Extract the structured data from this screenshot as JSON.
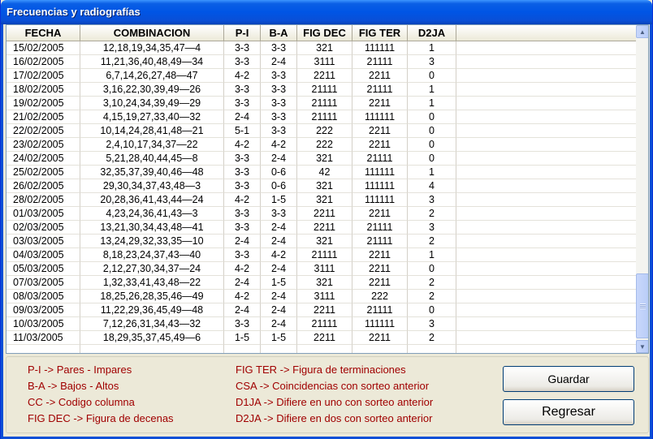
{
  "window": {
    "title": "Frecuencias y radiografías"
  },
  "table": {
    "headers": [
      "FECHA",
      "COMBINACION",
      "P-I",
      "B-A",
      "FIG DEC",
      "FIG TER",
      "D2JA",
      ""
    ],
    "rows": [
      [
        "15/02/2005",
        "12,18,19,34,35,47—4",
        "3-3",
        "3-3",
        "321",
        "111111",
        "1"
      ],
      [
        "16/02/2005",
        "11,21,36,40,48,49—34",
        "3-3",
        "2-4",
        "3111",
        "21111",
        "3"
      ],
      [
        "17/02/2005",
        "6,7,14,26,27,48—47",
        "4-2",
        "3-3",
        "2211",
        "2211",
        "0"
      ],
      [
        "18/02/2005",
        "3,16,22,30,39,49—26",
        "3-3",
        "3-3",
        "21111",
        "21111",
        "1"
      ],
      [
        "19/02/2005",
        "3,10,24,34,39,49—29",
        "3-3",
        "3-3",
        "21111",
        "2211",
        "1"
      ],
      [
        "21/02/2005",
        "4,15,19,27,33,40—32",
        "2-4",
        "3-3",
        "21111",
        "111111",
        "0"
      ],
      [
        "22/02/2005",
        "10,14,24,28,41,48—21",
        "5-1",
        "3-3",
        "222",
        "2211",
        "0"
      ],
      [
        "23/02/2005",
        "2,4,10,17,34,37—22",
        "4-2",
        "4-2",
        "222",
        "2211",
        "0"
      ],
      [
        "24/02/2005",
        "5,21,28,40,44,45—8",
        "3-3",
        "2-4",
        "321",
        "21111",
        "0"
      ],
      [
        "25/02/2005",
        "32,35,37,39,40,46—48",
        "3-3",
        "0-6",
        "42",
        "111111",
        "1"
      ],
      [
        "26/02/2005",
        "29,30,34,37,43,48—3",
        "3-3",
        "0-6",
        "321",
        "111111",
        "4"
      ],
      [
        "28/02/2005",
        "20,28,36,41,43,44—24",
        "4-2",
        "1-5",
        "321",
        "111111",
        "3"
      ],
      [
        "01/03/2005",
        "4,23,24,36,41,43—3",
        "3-3",
        "3-3",
        "2211",
        "2211",
        "2"
      ],
      [
        "02/03/2005",
        "13,21,30,34,43,48—41",
        "3-3",
        "2-4",
        "2211",
        "21111",
        "3"
      ],
      [
        "03/03/2005",
        "13,24,29,32,33,35—10",
        "2-4",
        "2-4",
        "321",
        "21111",
        "2"
      ],
      [
        "04/03/2005",
        "8,18,23,24,37,43—40",
        "3-3",
        "4-2",
        "21111",
        "2211",
        "1"
      ],
      [
        "05/03/2005",
        "2,12,27,30,34,37—24",
        "4-2",
        "2-4",
        "3111",
        "2211",
        "0"
      ],
      [
        "07/03/2005",
        "1,32,33,41,43,48—22",
        "2-4",
        "1-5",
        "321",
        "2211",
        "2"
      ],
      [
        "08/03/2005",
        "18,25,26,28,35,46—49",
        "4-2",
        "2-4",
        "3111",
        "222",
        "2"
      ],
      [
        "09/03/2005",
        "11,22,29,36,45,49—48",
        "2-4",
        "2-4",
        "2211",
        "21111",
        "0"
      ],
      [
        "10/03/2005",
        "7,12,26,31,34,43—32",
        "3-3",
        "2-4",
        "21111",
        "111111",
        "3"
      ],
      [
        "11/03/2005",
        "18,29,35,37,45,49—6",
        "1-5",
        "1-5",
        "2211",
        "2211",
        "2"
      ],
      [
        "",
        "",
        "",
        "",
        "",
        "",
        ""
      ]
    ]
  },
  "legend": {
    "left": [
      "P-I -> Pares - Impares",
      "B-A -> Bajos - Altos",
      "CC -> Codigo columna",
      "FIG DEC -> Figura de decenas"
    ],
    "right": [
      "FIG TER -> Figura de terminaciones",
      "CSA -> Coincidencias con sorteo anterior",
      "D1JA -> Difiere en uno con sorteo anterior",
      "D2JA -> Difiere en dos con sorteo anterior"
    ]
  },
  "buttons": {
    "save": "Guardar",
    "back": "Regresar"
  },
  "colors": {
    "legend_text": "#A00000",
    "title_bar": "#0055E5"
  },
  "icons": {
    "scroll_up": "scroll-up-arrow-icon",
    "scroll_down": "scroll-down-arrow-icon"
  }
}
